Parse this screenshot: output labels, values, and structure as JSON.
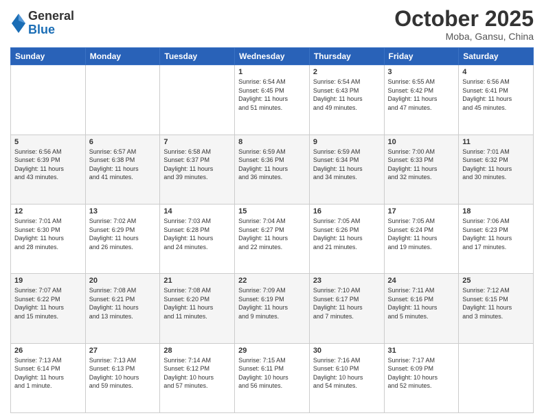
{
  "header": {
    "logo_general": "General",
    "logo_blue": "Blue",
    "title": "October 2025",
    "subtitle": "Moba, Gansu, China"
  },
  "weekdays": [
    "Sunday",
    "Monday",
    "Tuesday",
    "Wednesday",
    "Thursday",
    "Friday",
    "Saturday"
  ],
  "weeks": [
    [
      {
        "day": "",
        "info": ""
      },
      {
        "day": "",
        "info": ""
      },
      {
        "day": "",
        "info": ""
      },
      {
        "day": "1",
        "info": "Sunrise: 6:54 AM\nSunset: 6:45 PM\nDaylight: 11 hours\nand 51 minutes."
      },
      {
        "day": "2",
        "info": "Sunrise: 6:54 AM\nSunset: 6:43 PM\nDaylight: 11 hours\nand 49 minutes."
      },
      {
        "day": "3",
        "info": "Sunrise: 6:55 AM\nSunset: 6:42 PM\nDaylight: 11 hours\nand 47 minutes."
      },
      {
        "day": "4",
        "info": "Sunrise: 6:56 AM\nSunset: 6:41 PM\nDaylight: 11 hours\nand 45 minutes."
      }
    ],
    [
      {
        "day": "5",
        "info": "Sunrise: 6:56 AM\nSunset: 6:39 PM\nDaylight: 11 hours\nand 43 minutes."
      },
      {
        "day": "6",
        "info": "Sunrise: 6:57 AM\nSunset: 6:38 PM\nDaylight: 11 hours\nand 41 minutes."
      },
      {
        "day": "7",
        "info": "Sunrise: 6:58 AM\nSunset: 6:37 PM\nDaylight: 11 hours\nand 39 minutes."
      },
      {
        "day": "8",
        "info": "Sunrise: 6:59 AM\nSunset: 6:36 PM\nDaylight: 11 hours\nand 36 minutes."
      },
      {
        "day": "9",
        "info": "Sunrise: 6:59 AM\nSunset: 6:34 PM\nDaylight: 11 hours\nand 34 minutes."
      },
      {
        "day": "10",
        "info": "Sunrise: 7:00 AM\nSunset: 6:33 PM\nDaylight: 11 hours\nand 32 minutes."
      },
      {
        "day": "11",
        "info": "Sunrise: 7:01 AM\nSunset: 6:32 PM\nDaylight: 11 hours\nand 30 minutes."
      }
    ],
    [
      {
        "day": "12",
        "info": "Sunrise: 7:01 AM\nSunset: 6:30 PM\nDaylight: 11 hours\nand 28 minutes."
      },
      {
        "day": "13",
        "info": "Sunrise: 7:02 AM\nSunset: 6:29 PM\nDaylight: 11 hours\nand 26 minutes."
      },
      {
        "day": "14",
        "info": "Sunrise: 7:03 AM\nSunset: 6:28 PM\nDaylight: 11 hours\nand 24 minutes."
      },
      {
        "day": "15",
        "info": "Sunrise: 7:04 AM\nSunset: 6:27 PM\nDaylight: 11 hours\nand 22 minutes."
      },
      {
        "day": "16",
        "info": "Sunrise: 7:05 AM\nSunset: 6:26 PM\nDaylight: 11 hours\nand 21 minutes."
      },
      {
        "day": "17",
        "info": "Sunrise: 7:05 AM\nSunset: 6:24 PM\nDaylight: 11 hours\nand 19 minutes."
      },
      {
        "day": "18",
        "info": "Sunrise: 7:06 AM\nSunset: 6:23 PM\nDaylight: 11 hours\nand 17 minutes."
      }
    ],
    [
      {
        "day": "19",
        "info": "Sunrise: 7:07 AM\nSunset: 6:22 PM\nDaylight: 11 hours\nand 15 minutes."
      },
      {
        "day": "20",
        "info": "Sunrise: 7:08 AM\nSunset: 6:21 PM\nDaylight: 11 hours\nand 13 minutes."
      },
      {
        "day": "21",
        "info": "Sunrise: 7:08 AM\nSunset: 6:20 PM\nDaylight: 11 hours\nand 11 minutes."
      },
      {
        "day": "22",
        "info": "Sunrise: 7:09 AM\nSunset: 6:19 PM\nDaylight: 11 hours\nand 9 minutes."
      },
      {
        "day": "23",
        "info": "Sunrise: 7:10 AM\nSunset: 6:17 PM\nDaylight: 11 hours\nand 7 minutes."
      },
      {
        "day": "24",
        "info": "Sunrise: 7:11 AM\nSunset: 6:16 PM\nDaylight: 11 hours\nand 5 minutes."
      },
      {
        "day": "25",
        "info": "Sunrise: 7:12 AM\nSunset: 6:15 PM\nDaylight: 11 hours\nand 3 minutes."
      }
    ],
    [
      {
        "day": "26",
        "info": "Sunrise: 7:13 AM\nSunset: 6:14 PM\nDaylight: 11 hours\nand 1 minute."
      },
      {
        "day": "27",
        "info": "Sunrise: 7:13 AM\nSunset: 6:13 PM\nDaylight: 10 hours\nand 59 minutes."
      },
      {
        "day": "28",
        "info": "Sunrise: 7:14 AM\nSunset: 6:12 PM\nDaylight: 10 hours\nand 57 minutes."
      },
      {
        "day": "29",
        "info": "Sunrise: 7:15 AM\nSunset: 6:11 PM\nDaylight: 10 hours\nand 56 minutes."
      },
      {
        "day": "30",
        "info": "Sunrise: 7:16 AM\nSunset: 6:10 PM\nDaylight: 10 hours\nand 54 minutes."
      },
      {
        "day": "31",
        "info": "Sunrise: 7:17 AM\nSunset: 6:09 PM\nDaylight: 10 hours\nand 52 minutes."
      },
      {
        "day": "",
        "info": ""
      }
    ]
  ]
}
